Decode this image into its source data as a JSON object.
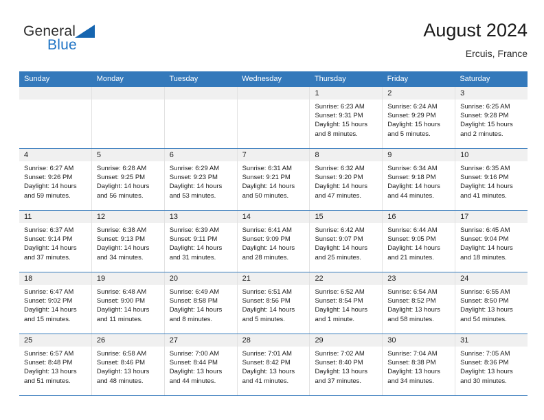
{
  "brand": {
    "general": "General",
    "blue": "Blue",
    "triangle_icon": "triangle-icon",
    "accent_color": "#1c72c4"
  },
  "header": {
    "title": "August 2024",
    "subtitle": "Ercuis, France"
  },
  "theme": {
    "header_blue": "#3479bb",
    "day_band_gray": "#f0f0f0",
    "cell_border": "#e2e2e2"
  },
  "weekdays": [
    "Sunday",
    "Monday",
    "Tuesday",
    "Wednesday",
    "Thursday",
    "Friday",
    "Saturday"
  ],
  "labels": {
    "sunrise": "Sunrise:",
    "sunset": "Sunset:",
    "daylight": "Daylight:"
  },
  "weeks": [
    [
      {
        "day": "",
        "sunrise": "",
        "sunset": "",
        "daylight": ""
      },
      {
        "day": "",
        "sunrise": "",
        "sunset": "",
        "daylight": ""
      },
      {
        "day": "",
        "sunrise": "",
        "sunset": "",
        "daylight": ""
      },
      {
        "day": "",
        "sunrise": "",
        "sunset": "",
        "daylight": ""
      },
      {
        "day": "1",
        "sunrise": "Sunrise: 6:23 AM",
        "sunset": "Sunset: 9:31 PM",
        "daylight": "Daylight: 15 hours and 8 minutes."
      },
      {
        "day": "2",
        "sunrise": "Sunrise: 6:24 AM",
        "sunset": "Sunset: 9:29 PM",
        "daylight": "Daylight: 15 hours and 5 minutes."
      },
      {
        "day": "3",
        "sunrise": "Sunrise: 6:25 AM",
        "sunset": "Sunset: 9:28 PM",
        "daylight": "Daylight: 15 hours and 2 minutes."
      }
    ],
    [
      {
        "day": "4",
        "sunrise": "Sunrise: 6:27 AM",
        "sunset": "Sunset: 9:26 PM",
        "daylight": "Daylight: 14 hours and 59 minutes."
      },
      {
        "day": "5",
        "sunrise": "Sunrise: 6:28 AM",
        "sunset": "Sunset: 9:25 PM",
        "daylight": "Daylight: 14 hours and 56 minutes."
      },
      {
        "day": "6",
        "sunrise": "Sunrise: 6:29 AM",
        "sunset": "Sunset: 9:23 PM",
        "daylight": "Daylight: 14 hours and 53 minutes."
      },
      {
        "day": "7",
        "sunrise": "Sunrise: 6:31 AM",
        "sunset": "Sunset: 9:21 PM",
        "daylight": "Daylight: 14 hours and 50 minutes."
      },
      {
        "day": "8",
        "sunrise": "Sunrise: 6:32 AM",
        "sunset": "Sunset: 9:20 PM",
        "daylight": "Daylight: 14 hours and 47 minutes."
      },
      {
        "day": "9",
        "sunrise": "Sunrise: 6:34 AM",
        "sunset": "Sunset: 9:18 PM",
        "daylight": "Daylight: 14 hours and 44 minutes."
      },
      {
        "day": "10",
        "sunrise": "Sunrise: 6:35 AM",
        "sunset": "Sunset: 9:16 PM",
        "daylight": "Daylight: 14 hours and 41 minutes."
      }
    ],
    [
      {
        "day": "11",
        "sunrise": "Sunrise: 6:37 AM",
        "sunset": "Sunset: 9:14 PM",
        "daylight": "Daylight: 14 hours and 37 minutes."
      },
      {
        "day": "12",
        "sunrise": "Sunrise: 6:38 AM",
        "sunset": "Sunset: 9:13 PM",
        "daylight": "Daylight: 14 hours and 34 minutes."
      },
      {
        "day": "13",
        "sunrise": "Sunrise: 6:39 AM",
        "sunset": "Sunset: 9:11 PM",
        "daylight": "Daylight: 14 hours and 31 minutes."
      },
      {
        "day": "14",
        "sunrise": "Sunrise: 6:41 AM",
        "sunset": "Sunset: 9:09 PM",
        "daylight": "Daylight: 14 hours and 28 minutes."
      },
      {
        "day": "15",
        "sunrise": "Sunrise: 6:42 AM",
        "sunset": "Sunset: 9:07 PM",
        "daylight": "Daylight: 14 hours and 25 minutes."
      },
      {
        "day": "16",
        "sunrise": "Sunrise: 6:44 AM",
        "sunset": "Sunset: 9:05 PM",
        "daylight": "Daylight: 14 hours and 21 minutes."
      },
      {
        "day": "17",
        "sunrise": "Sunrise: 6:45 AM",
        "sunset": "Sunset: 9:04 PM",
        "daylight": "Daylight: 14 hours and 18 minutes."
      }
    ],
    [
      {
        "day": "18",
        "sunrise": "Sunrise: 6:47 AM",
        "sunset": "Sunset: 9:02 PM",
        "daylight": "Daylight: 14 hours and 15 minutes."
      },
      {
        "day": "19",
        "sunrise": "Sunrise: 6:48 AM",
        "sunset": "Sunset: 9:00 PM",
        "daylight": "Daylight: 14 hours and 11 minutes."
      },
      {
        "day": "20",
        "sunrise": "Sunrise: 6:49 AM",
        "sunset": "Sunset: 8:58 PM",
        "daylight": "Daylight: 14 hours and 8 minutes."
      },
      {
        "day": "21",
        "sunrise": "Sunrise: 6:51 AM",
        "sunset": "Sunset: 8:56 PM",
        "daylight": "Daylight: 14 hours and 5 minutes."
      },
      {
        "day": "22",
        "sunrise": "Sunrise: 6:52 AM",
        "sunset": "Sunset: 8:54 PM",
        "daylight": "Daylight: 14 hours and 1 minute."
      },
      {
        "day": "23",
        "sunrise": "Sunrise: 6:54 AM",
        "sunset": "Sunset: 8:52 PM",
        "daylight": "Daylight: 13 hours and 58 minutes."
      },
      {
        "day": "24",
        "sunrise": "Sunrise: 6:55 AM",
        "sunset": "Sunset: 8:50 PM",
        "daylight": "Daylight: 13 hours and 54 minutes."
      }
    ],
    [
      {
        "day": "25",
        "sunrise": "Sunrise: 6:57 AM",
        "sunset": "Sunset: 8:48 PM",
        "daylight": "Daylight: 13 hours and 51 minutes."
      },
      {
        "day": "26",
        "sunrise": "Sunrise: 6:58 AM",
        "sunset": "Sunset: 8:46 PM",
        "daylight": "Daylight: 13 hours and 48 minutes."
      },
      {
        "day": "27",
        "sunrise": "Sunrise: 7:00 AM",
        "sunset": "Sunset: 8:44 PM",
        "daylight": "Daylight: 13 hours and 44 minutes."
      },
      {
        "day": "28",
        "sunrise": "Sunrise: 7:01 AM",
        "sunset": "Sunset: 8:42 PM",
        "daylight": "Daylight: 13 hours and 41 minutes."
      },
      {
        "day": "29",
        "sunrise": "Sunrise: 7:02 AM",
        "sunset": "Sunset: 8:40 PM",
        "daylight": "Daylight: 13 hours and 37 minutes."
      },
      {
        "day": "30",
        "sunrise": "Sunrise: 7:04 AM",
        "sunset": "Sunset: 8:38 PM",
        "daylight": "Daylight: 13 hours and 34 minutes."
      },
      {
        "day": "31",
        "sunrise": "Sunrise: 7:05 AM",
        "sunset": "Sunset: 8:36 PM",
        "daylight": "Daylight: 13 hours and 30 minutes."
      }
    ]
  ]
}
